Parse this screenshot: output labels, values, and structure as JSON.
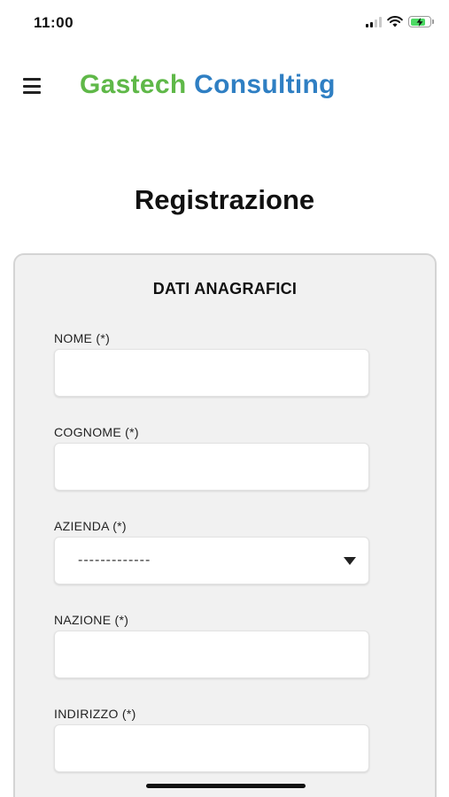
{
  "status_bar": {
    "time": "11:00",
    "battery_level": 0.8,
    "icons": [
      "signal-icon",
      "wifi-icon",
      "battery-charging-icon"
    ]
  },
  "header": {
    "brand_part1": "Gastech",
    "brand_part2": "Consulting",
    "brand_colors": {
      "green": "#5fb848",
      "blue": "#2f7fc3"
    },
    "menu_icon": "hamburger-menu-icon"
  },
  "page": {
    "title": "Registrazione"
  },
  "form": {
    "section_title": "DATI ANAGRAFICI",
    "fields": {
      "nome": {
        "label": "NOME (*)",
        "value": ""
      },
      "cognome": {
        "label": "COGNOME (*)",
        "value": ""
      },
      "azienda": {
        "label": "AZIENDA (*)",
        "selected": "-------------"
      },
      "nazione": {
        "label": "NAZIONE (*)",
        "value": ""
      },
      "indirizzo": {
        "label": "INDIRIZZO (*)",
        "value": ""
      }
    }
  }
}
